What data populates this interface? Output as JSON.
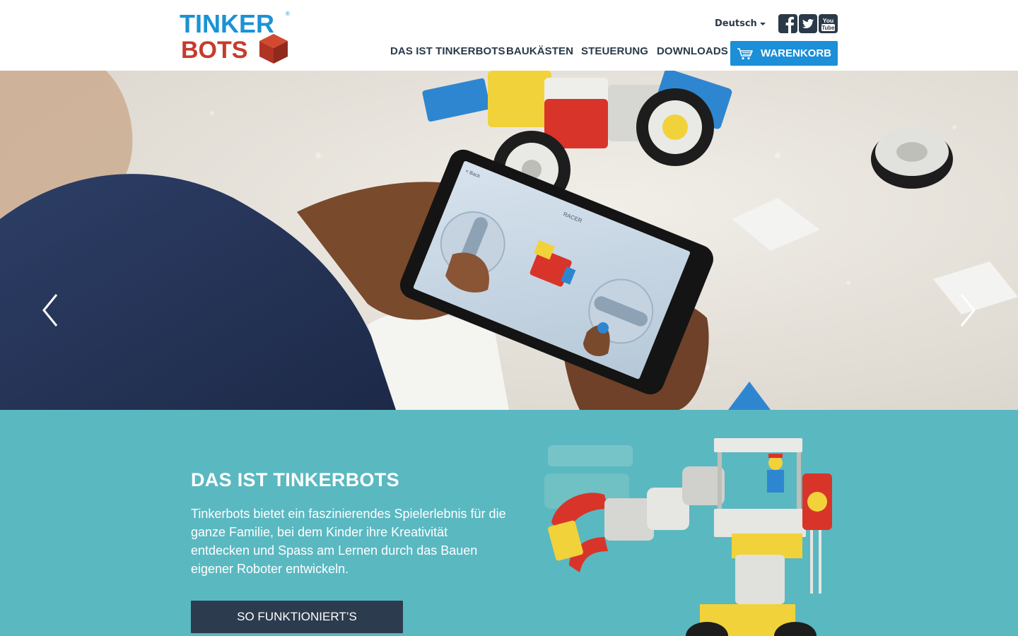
{
  "brand": {
    "logo_top": "TINKER",
    "logo_bottom": "BOTS",
    "accent": "#1b8fd8",
    "logo_blue": "#1a93d4",
    "logo_red": "#c63b2b"
  },
  "header": {
    "language": "Deutsch",
    "social": [
      {
        "name": "facebook-icon"
      },
      {
        "name": "twitter-icon"
      },
      {
        "name": "youtube-icon",
        "text": "You Tube"
      }
    ],
    "nav": [
      {
        "label": "DAS IST TINKERBOTS"
      },
      {
        "label": "BAUKÄSTEN"
      },
      {
        "label": "STEUERUNG"
      },
      {
        "label": "DOWNLOADS"
      }
    ],
    "cart_label": "WARENKORB"
  },
  "hero": {
    "slides": 2,
    "active_slide": 1,
    "app_screen_title": "RACER",
    "app_back_label": "< Back"
  },
  "intro": {
    "heading": "DAS IST TINKERBOTS",
    "body": "Tinkerbots bietet ein faszinierendes Spielerlebnis für die ganze Familie, bei dem Kinder ihre Kreativität entdecken und Spass am Lernen durch das Bauen eigener Roboter entwickeln.",
    "cta_label": "SO FUNKTIONIERT’S",
    "background": "#5ab8c1",
    "cta_color": "#2c3b4e"
  }
}
